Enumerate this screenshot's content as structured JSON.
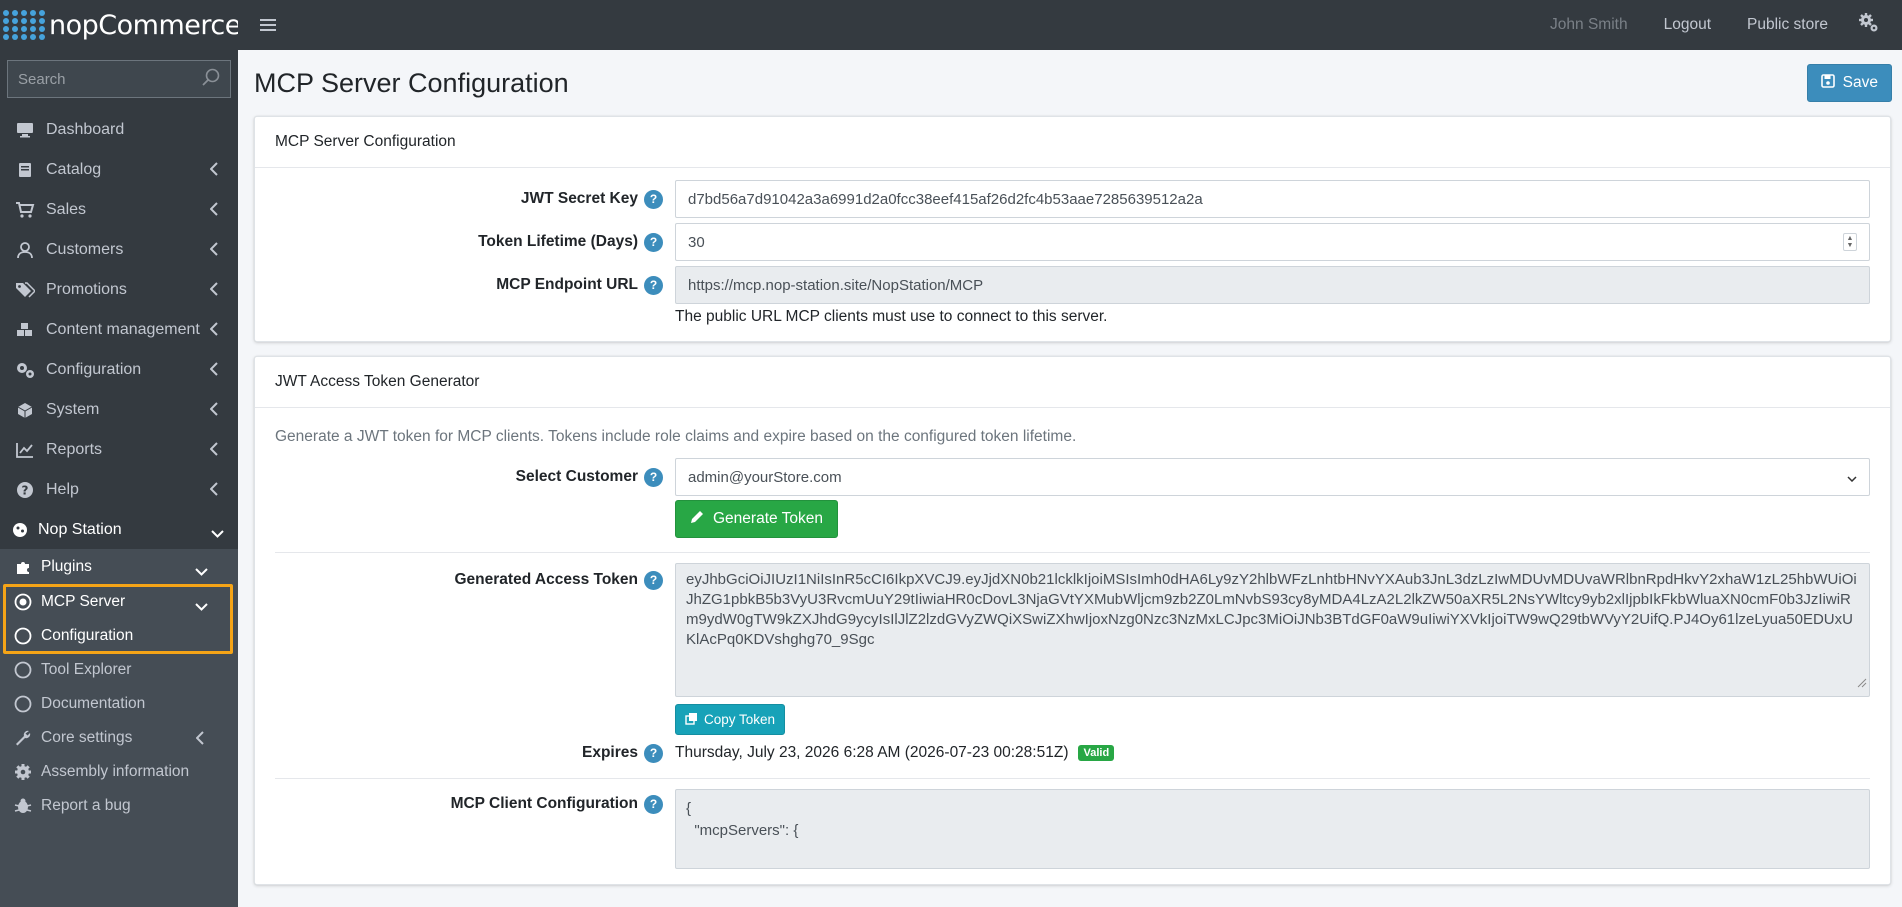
{
  "brand": {
    "name": "nopCommerce"
  },
  "search": {
    "placeholder": "Search"
  },
  "sidebar": {
    "items": [
      {
        "label": "Dashboard",
        "icon": "monitor-icon"
      },
      {
        "label": "Catalog",
        "icon": "book-icon"
      },
      {
        "label": "Sales",
        "icon": "cart-icon"
      },
      {
        "label": "Customers",
        "icon": "user-icon"
      },
      {
        "label": "Promotions",
        "icon": "tags-icon"
      },
      {
        "label": "Content management",
        "icon": "cubes-icon"
      },
      {
        "label": "Configuration",
        "icon": "gears-icon"
      },
      {
        "label": "System",
        "icon": "cube-icon"
      },
      {
        "label": "Reports",
        "icon": "chart-icon"
      },
      {
        "label": "Help",
        "icon": "question-icon"
      }
    ],
    "nop_station": "Nop Station",
    "plugins": "Plugins",
    "mcp_server": "MCP Server",
    "configuration": "Configuration",
    "tool_explorer": "Tool Explorer",
    "documentation": "Documentation",
    "core_settings": "Core settings",
    "assembly_information": "Assembly information",
    "report_bug": "Report a bug"
  },
  "topbar": {
    "user": "John Smith",
    "logout": "Logout",
    "public_store": "Public store"
  },
  "page": {
    "title": "MCP Server Configuration",
    "save_label": "Save"
  },
  "config_card": {
    "header": "MCP Server Configuration",
    "jwt_secret_label": "JWT Secret Key",
    "jwt_secret_value": "d7bd56a7d91042a3a6991d2a0fcc38eef415af26d2fc4b53aae7285639512a2a",
    "token_lifetime_label": "Token Lifetime (Days)",
    "token_lifetime_value": "30",
    "endpoint_label": "MCP Endpoint URL",
    "endpoint_value": "https://mcp.nop-station.site/NopStation/MCP",
    "endpoint_hint": "The public URL MCP clients must use to connect to this server."
  },
  "token_card": {
    "header": "JWT Access Token Generator",
    "description": "Generate a JWT token for MCP clients. Tokens include role claims and expire based on the configured token lifetime.",
    "select_customer_label": "Select Customer",
    "select_customer_value": "admin@yourStore.com",
    "generate_label": "Generate Token",
    "generated_label": "Generated Access Token",
    "generated_value": "eyJhbGciOiJIUzI1NiIsInR5cCI6IkpXVCJ9.eyJjdXN0b21lcklkIjoiMSIsImh0dHA6Ly9zY2hlbWFzLnhtbHNvYXAub3JnL3dzLzIwMDUvMDUvaWRlbnRpdHkvY2xhaW1zL25hbWUiOiJhZG1pbkB5b3VyU3RvcmUuY29tIiwiaHR0cDovL3NjaGVtYXMubWljcm9zb2Z0LmNvbS93cy8yMDA4LzA2L2lkZW50aXR5L2NsYWltcy9yb2xlIjpbIkFkbWluaXN0cmF0b3JzIiwiRm9ydW0gTW9kZXJhdG9ycyIsIlJlZ2lzdGVyZWQiXSwiZXhwIjoxNzg0Nzc3NzMxLCJpc3MiOiJNb3BTdGF0aW9uIiwiYXVkIjoiTW9wQ29tbWVyY2UifQ.PJ4Oy61lzeLyua50EDUxUKlAcPq0KDVshghg70_9Sgc",
    "copy_label": "Copy Token",
    "expires_label": "Expires",
    "expires_value": "Thursday, July 23, 2026 6:28 AM (2026-07-23 00:28:51Z)",
    "valid_badge": "Valid",
    "client_config_label": "MCP Client Configuration",
    "client_config_line1": "{",
    "client_config_line2": "  \"mcpServers\": {"
  },
  "colors": {
    "sidebar_bg": "#343a40",
    "accent_blue": "#3c8dbc",
    "success": "#28a745",
    "info": "#17a2b8",
    "highlight": "#f5a417"
  }
}
